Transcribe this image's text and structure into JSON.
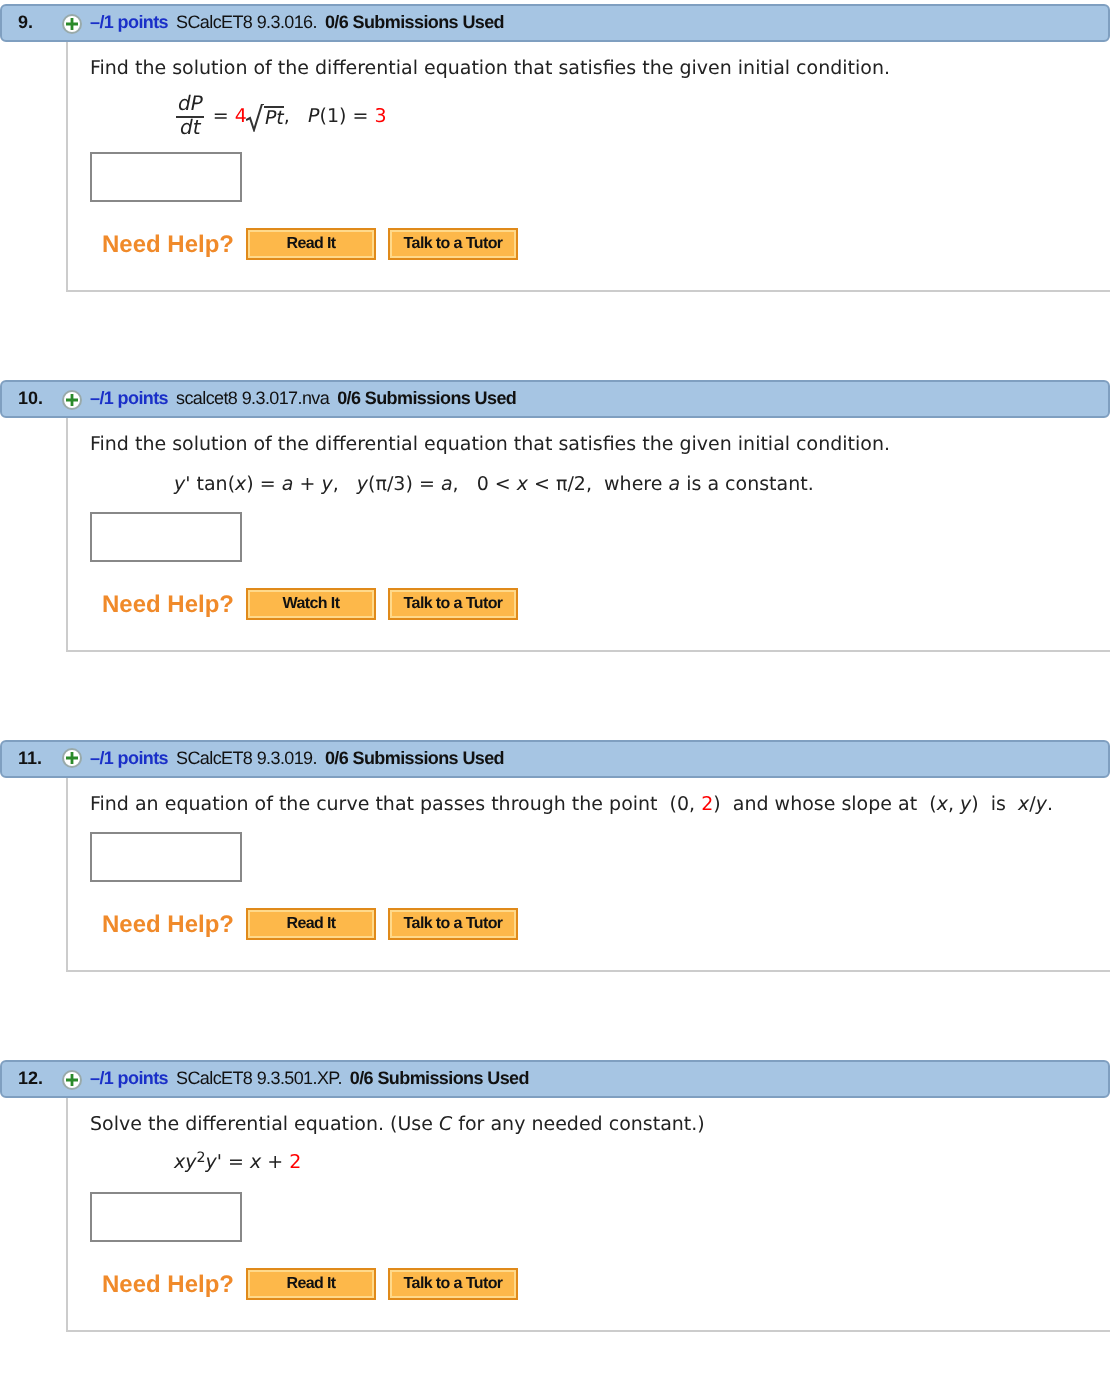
{
  "questions": [
    {
      "number": "9.",
      "points": "–/1 points",
      "code": "SCalcET8 9.3.016.",
      "submissions": "0/6 Submissions Used",
      "prompt": [
        {
          "kind": "plain",
          "text": "Find the solution of the differential equation that satisfies the given initial condition."
        }
      ],
      "equation": [
        {
          "kind": "fraction",
          "num": "dP",
          "den": "dt"
        },
        {
          "kind": "plain",
          "text": " = "
        },
        {
          "kind": "given",
          "text": "4"
        },
        {
          "kind": "sqrt",
          "text": "Pt"
        },
        {
          "kind": "plain",
          "text": ",   *P*(1) = "
        },
        {
          "kind": "given",
          "text": "3"
        }
      ],
      "help_label": "Need Help?",
      "help_buttons": [
        "Read It",
        "Talk to a Tutor"
      ]
    },
    {
      "number": "10.",
      "points": "–/1 points",
      "code": "scalcet8 9.3.017.nva",
      "submissions": "0/6 Submissions Used",
      "prompt": [
        {
          "kind": "plain",
          "text": "Find the solution of the differential equation that satisfies the given initial condition."
        }
      ],
      "equation": [
        {
          "kind": "plain",
          "text": "*y*' tan(*x*) = *a* + *y*,   *y*(π/3) = *a*,   0 < *x* < π/2,  where *a* is a constant."
        }
      ],
      "help_label": "Need Help?",
      "help_buttons": [
        "Watch It",
        "Talk to a Tutor"
      ]
    },
    {
      "number": "11.",
      "points": "–/1 points",
      "code": "SCalcET8 9.3.019.",
      "submissions": "0/6 Submissions Used",
      "prompt": [
        {
          "kind": "plain",
          "text": "Find an equation of the curve that passes through the point  (0, "
        },
        {
          "kind": "given",
          "text": "2"
        },
        {
          "kind": "plain",
          "text": ")  and whose slope at  (*x*, *y*)  is  *x*/*y*."
        }
      ],
      "help_label": "Need Help?",
      "help_buttons": [
        "Read It",
        "Talk to a Tutor"
      ]
    },
    {
      "number": "12.",
      "points": "–/1 points",
      "code": "SCalcET8 9.3.501.XP.",
      "submissions": "0/6 Submissions Used",
      "prompt": [
        {
          "kind": "plain",
          "text": "Solve the differential equation. (Use *C* for any needed constant.)"
        }
      ],
      "equation": [
        {
          "kind": "plain",
          "text": "*xy*$^{2}$*y*' = *x* + "
        },
        {
          "kind": "given",
          "text": "2"
        }
      ],
      "help_label": "Need Help?",
      "help_buttons": [
        "Read It",
        "Talk to a Tutor"
      ]
    }
  ]
}
